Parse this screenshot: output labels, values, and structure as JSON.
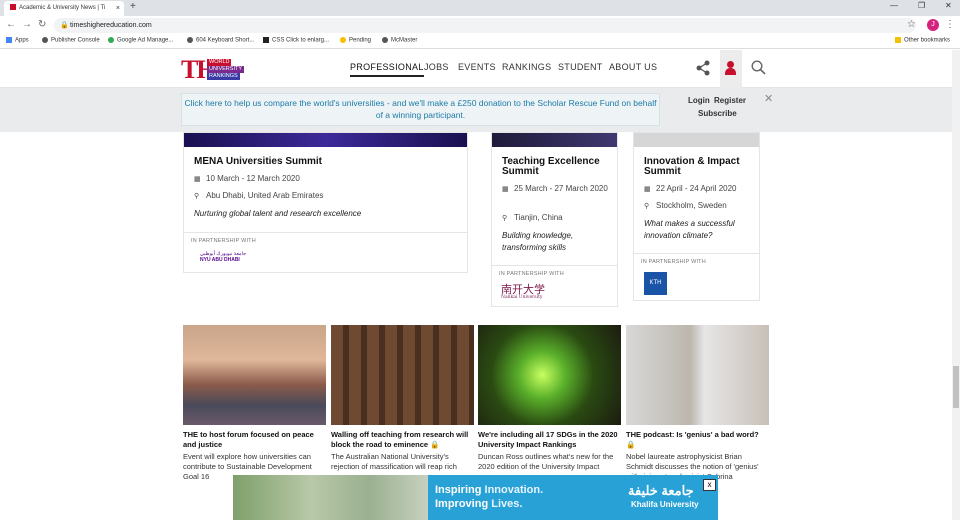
{
  "browser": {
    "tab_title": "Academic & University News | Ti",
    "url": "timeshighereducation.com",
    "profile_initial": "J",
    "bookmarks": [
      "Apps",
      "Publisher Console",
      "Google Ad Manage...",
      "604 Keyboard Short...",
      "CSS Click to enlarg...",
      "Pending",
      "McMaster"
    ],
    "other_bookmarks": "Other bookmarks"
  },
  "header": {
    "logo_the": "THE",
    "logo_lines": [
      "WORLD",
      "UNIVERSITY",
      "RANKINGS"
    ],
    "nav": [
      "PROFESSIONAL",
      "JOBS",
      "EVENTS",
      "RANKINGS",
      "STUDENT",
      "ABOUT US"
    ],
    "brand_color": "#c8102e"
  },
  "banner": {
    "message": "Click here to help us compare the world's universities - and we'll make a £250 donation to the Scholar Rescue Fund on behalf of a winning participant.",
    "login": "Login",
    "register": "Register",
    "subscribe": "Subscribe"
  },
  "events": [
    {
      "title": "MENA Universities Summit",
      "date": "10 March - 12 March 2020",
      "location": "Abu Dhabi, United Arab Emirates",
      "tagline": "Nurturing global talent and research excellence",
      "partner_label": "IN PARTNERSHIP WITH",
      "partner": "NYU ABU DHABI"
    },
    {
      "title": "Teaching Excellence Summit",
      "date": "25 March - 27 March 2020",
      "location": "Tianjin, China",
      "tagline": "Building knowledge, transforming skills",
      "partner_label": "IN PARTNERSHIP WITH",
      "partner": "Nankai University"
    },
    {
      "title": "Innovation & Impact Summit",
      "date": "22 April - 24 April 2020",
      "location": "Stockholm, Sweden",
      "tagline": "What makes a successful innovation climate?",
      "partner_label": "IN PARTNERSHIP WITH",
      "partner": "KTH"
    }
  ],
  "articles": [
    {
      "title": "THE to host forum focused on peace and justice",
      "summary": "Event will explore how universities can contribute to Sustainable Development Goal 16"
    },
    {
      "title": "Walling off teaching from research will block the road to eminence 🔒",
      "summary": "The Australian National University's rejection of massification will reap rich"
    },
    {
      "title": "We're including all 17 SDGs in the 2020 University Impact Rankings",
      "summary": "Duncan Ross outlines what's new for the 2020 edition of the University Impact"
    },
    {
      "title": "THE podcast: Is 'genius' a bad word? 🔒",
      "summary": "Nobel laureate astrophysicist Brian Schmidt discusses the notion of 'genius' with rising star physicist Sabrina Gonzalez..."
    }
  ],
  "ad": {
    "line1_a": "Inspiring",
    "line1_b": " Innovation.",
    "line2_a": "Improving",
    "line2_b": " Lives.",
    "arabic": "جامعة خليفة",
    "brand": "Khalifa University",
    "close": "x"
  }
}
